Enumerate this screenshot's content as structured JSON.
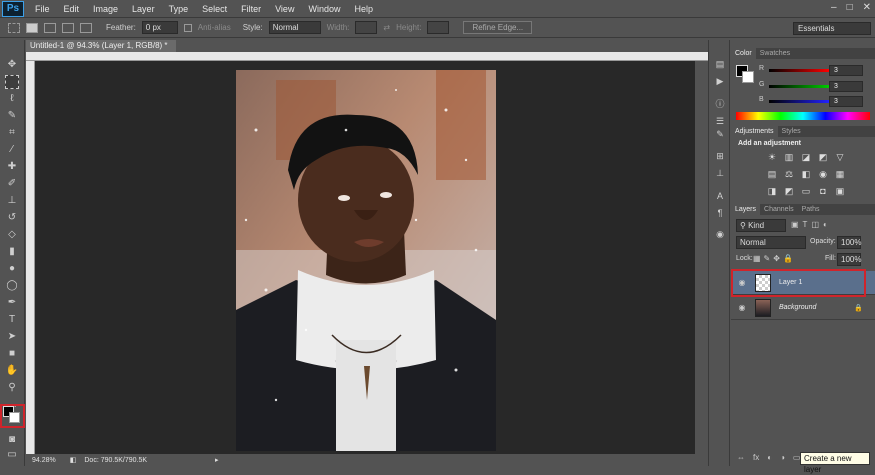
{
  "app": {
    "logo": "Ps"
  },
  "menu": [
    "File",
    "Edit",
    "Image",
    "Layer",
    "Type",
    "Select",
    "Filter",
    "View",
    "Window",
    "Help"
  ],
  "window_controls": [
    "–",
    "□",
    "✕"
  ],
  "options": {
    "feather_label": "Feather:",
    "feather_value": "0 px",
    "antialias_label": "Anti-alias",
    "style_label": "Style:",
    "style_value": "Normal",
    "width_label": "Width:",
    "height_label": "Height:",
    "refine_edge": "Refine Edge..."
  },
  "workspace": "Essentials",
  "document": {
    "tab_title": "Untitled-1 @ 94.3% (Layer 1, RGB/8) *",
    "close": "×",
    "zoom": "94.28%",
    "doc_size": "Doc: 790.5K/790.5K"
  },
  "color_panel": {
    "tabs": [
      "Color",
      "Swatches"
    ],
    "rows": [
      {
        "label": "R",
        "value": "3"
      },
      {
        "label": "G",
        "value": "3"
      },
      {
        "label": "B",
        "value": "3"
      }
    ]
  },
  "adjustments_panel": {
    "tabs": [
      "Adjustments",
      "Styles"
    ],
    "heading": "Add an adjustment",
    "row1": [
      "☀",
      "▥",
      "◪",
      "◩",
      "▽"
    ],
    "row2": [
      "▤",
      "⚖",
      "◧",
      "◉",
      "▦"
    ],
    "row3": [
      "◨",
      "◩",
      "▭",
      "◘",
      "▣"
    ]
  },
  "layers_panel": {
    "tabs": [
      "Layers",
      "Channels",
      "Paths"
    ],
    "kind_label": "Kind",
    "blend_mode": "Normal",
    "opacity_label": "Opacity:",
    "opacity_value": "100%",
    "lock_label": "Lock:",
    "fill_label": "Fill:",
    "fill_value": "100%",
    "layers": [
      {
        "name": "Layer 1"
      },
      {
        "name": "Background"
      }
    ],
    "footer_icons": [
      "⇔",
      "fx",
      "◐",
      "◑",
      "▭",
      "▣",
      "🗑"
    ]
  },
  "tooltip": "Create a new layer",
  "colors": {
    "highlight": "#d0242b",
    "selected_layer": "#5a6f8c"
  }
}
